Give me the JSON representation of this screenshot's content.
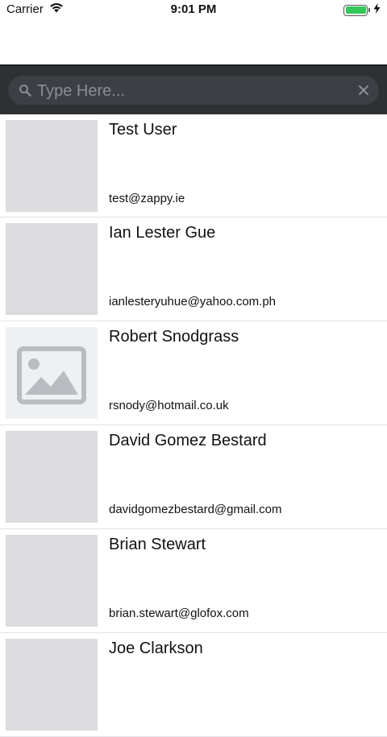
{
  "status_bar": {
    "carrier": "Carrier",
    "time": "9:01 PM",
    "battery_level": 1.0
  },
  "search": {
    "placeholder": "Type Here..."
  },
  "icons": {
    "search": "magnifier-icon",
    "clear": "close-icon",
    "thumb_placeholder": "image-placeholder-icon"
  },
  "users": [
    {
      "name": "Test User",
      "email": "test@zappy.ie"
    },
    {
      "name": "Ian Lester Gue",
      "email": "ianlesteryuhue@yahoo.com.ph"
    },
    {
      "name": "Robert Snodgrass",
      "email": "rsnody@hotmail.co.uk"
    },
    {
      "name": "David Gomez Bestard",
      "email": "davidgomezbestard@gmail.com"
    },
    {
      "name": "Brian Stewart",
      "email": "brian.stewart@glofox.com"
    },
    {
      "name": "Joe Clarkson",
      "email": ""
    }
  ],
  "colors": {
    "header_bg": "#2e3033",
    "search_bg": "#3c3f43",
    "battery": "#34c759"
  }
}
